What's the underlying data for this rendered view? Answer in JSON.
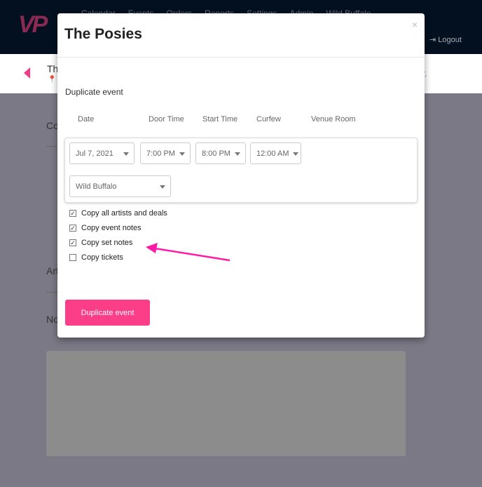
{
  "nav": {
    "logo": "VP",
    "items": [
      "Calendar",
      "Events",
      "Orders",
      "Reports",
      "Settings",
      "Admin",
      "Wild Buffalo"
    ],
    "logout": "Logout"
  },
  "background": {
    "event_title_partial": "Th",
    "link_partial": "ry.",
    "sections": [
      "Co",
      "Art",
      "No"
    ]
  },
  "modal": {
    "title": "The Posies",
    "close": "×",
    "subtitle": "Duplicate event",
    "columns": [
      "Date",
      "Door Time",
      "Start Time",
      "Curfew",
      "Venue Room"
    ],
    "date": "Jul 7, 2021",
    "door_time": "7:00 PM",
    "start_time": "8:00 PM",
    "curfew": "12:00 AM",
    "venue_room": "Wild Buffalo",
    "options": [
      {
        "label": "Copy all artists and deals",
        "checked": true
      },
      {
        "label": "Copy event notes",
        "checked": true
      },
      {
        "label": "Copy set notes",
        "checked": true
      },
      {
        "label": "Copy tickets",
        "checked": false
      }
    ],
    "submit": "Duplicate event"
  },
  "annotation": {
    "arrow_color": "#ff1aa8"
  }
}
